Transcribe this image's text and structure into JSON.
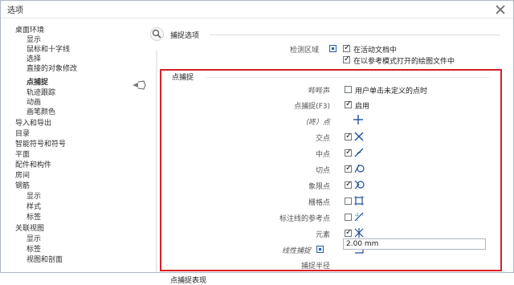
{
  "window": {
    "title": "选项"
  },
  "sidebar": {
    "items": [
      {
        "label": "桌面环境"
      },
      {
        "label": "显示"
      },
      {
        "label": "鼠标和十字线"
      },
      {
        "label": "选择"
      },
      {
        "label": "直接的对象修改"
      },
      {
        "label": "点捕捉"
      },
      {
        "label": "轨迹跟踪"
      },
      {
        "label": "动画"
      },
      {
        "label": "画笔颜色"
      },
      {
        "label": "导入和导出"
      },
      {
        "label": "目录"
      },
      {
        "label": "智能符号和符号"
      },
      {
        "label": "平面"
      },
      {
        "label": "配件和构件"
      },
      {
        "label": "房间"
      },
      {
        "label": "钢筋"
      },
      {
        "label": "显示"
      },
      {
        "label": "样式"
      },
      {
        "label": "标签"
      },
      {
        "label": "关联视图"
      },
      {
        "label": "显示"
      },
      {
        "label": "标签"
      },
      {
        "label": "视图和剖面"
      }
    ]
  },
  "main": {
    "capture_options_title": "捕捉选项",
    "detection_area_label": "检测区域",
    "detection_options": [
      {
        "label": "在活动文档中",
        "checked": true
      },
      {
        "label": "在以参考模式打开的绘图文件中",
        "checked": true
      }
    ],
    "point_snap": {
      "title": "点捕捉",
      "rows": [
        {
          "label": "哔哔声",
          "checkbox": false,
          "text": "用户单击未定义的点时",
          "icon": null
        },
        {
          "label": "点捕捉(F3)",
          "checkbox": true,
          "text": "启用",
          "icon": null
        },
        {
          "label": "（咚）点",
          "checkbox": null,
          "text": "",
          "icon": "plus"
        },
        {
          "label": "交点",
          "checkbox": true,
          "text": "",
          "icon": "intersection-x"
        },
        {
          "label": "中点",
          "checkbox": true,
          "text": "",
          "icon": "midpoint"
        },
        {
          "label": "切点",
          "checkbox": true,
          "text": "",
          "icon": "tangent"
        },
        {
          "label": "象限点",
          "checkbox": true,
          "text": "",
          "icon": "quadrant"
        },
        {
          "label": "栅格点",
          "checkbox": false,
          "text": "",
          "icon": "grid-square"
        },
        {
          "label": "标注线的参考点",
          "checkbox": false,
          "text": "",
          "icon": "dimension-reference"
        },
        {
          "label": "元素",
          "checkbox": true,
          "text": "",
          "icon": "element"
        },
        {
          "label": "线性捕捉",
          "checkbox": null,
          "text": "",
          "icon": "linear-snap"
        },
        {
          "label": "捕捉半径",
          "checkbox": null,
          "text": "",
          "icon": null
        }
      ],
      "snap_radius_value": "2.00 mm"
    },
    "bottom_title": "点捕捉表现"
  }
}
